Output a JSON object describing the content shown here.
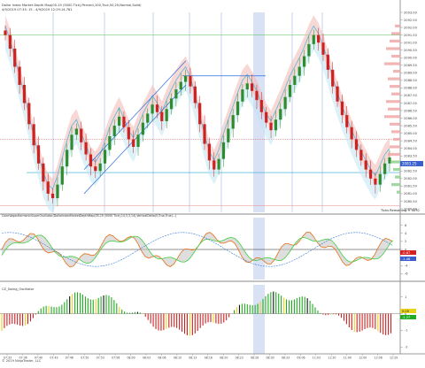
{
  "header": {
    "line1": "Dollar Index Market Depth Map(05-19 (5000 Tick),Percent,100,True,50,20,Normal,Solid)",
    "line2": "4/9/2019 07:33: 15 - 4/9/2019 12:29:14.761"
  },
  "price_panel": {
    "y_ticks": [
      "2093.00",
      "2092.50",
      "2092.00",
      "2091.50",
      "2091.00",
      "2090.50",
      "2090.00",
      "2089.50",
      "2089.00",
      "2088.50",
      "2088.00",
      "2087.50",
      "2087.00",
      "2086.50",
      "2086.00",
      "2085.50",
      "2085.00",
      "2084.50",
      "2084.00",
      "2083.50",
      "2083.00",
      "2082.50",
      "2082.00",
      "2081.50",
      "2081.00",
      "2080.50",
      "2080.00"
    ],
    "last_price": "2083.25",
    "ticks_remaining": "Ticks Remaining = 3070"
  },
  "momentum_panel": {
    "label": "ColorVagosHarmonicSuperOscillator(DollarIndexMarketDepthMap(05-19 (5000 Tick),14,3,3,14),VerticalDelta(5,True,True)...)",
    "y_ticks": [
      "6",
      "4",
      "2",
      "0",
      "-2",
      "-4",
      "-6"
    ],
    "value_labels": [
      "-0.87",
      "-1.46"
    ]
  },
  "oscillator_panel": {
    "label": "CZ_Swing_Oscillator",
    "y_ticks": [
      "1",
      "0",
      "-1",
      "-2"
    ],
    "value_labels": [
      "0.00",
      "-1.27"
    ]
  },
  "time_axis": {
    "ticks": [
      "07:33",
      "07:36",
      "07:40",
      "07:43",
      "07:46",
      "07:50",
      "07:53",
      "07:56",
      "08:00",
      "08:03",
      "08:06",
      "08:10",
      "08:13",
      "08:16",
      "08:20",
      "08:23",
      "08:26",
      "08:30",
      "08:33",
      "09:06",
      "11:03",
      "11:20",
      "11:40",
      "12:00",
      "12:06",
      "12:29"
    ]
  },
  "footer": {
    "copyright": "© 2019 NinjaTrader, LLC"
  },
  "colors": {
    "up_candle": "#2e8b2e",
    "down_candle": "#cc2222",
    "envelope_upper": "#f2b8b0",
    "envelope_lower": "#bfe6f2",
    "trend_band": "#9ad0ee",
    "hist_pos": "#22aa22",
    "hist_neg": "#cc2222",
    "hist_yellow": "#e8d21e"
  },
  "chart_data": {
    "type": "candlestick",
    "ylim": [
      2080,
      2093
    ],
    "closes": [
      2091.5,
      2090.6,
      2089.4,
      2088.2,
      2087.0,
      2085.6,
      2084.2,
      2083.0,
      2081.8,
      2081.0,
      2080.7,
      2081.6,
      2082.8,
      2083.9,
      2084.9,
      2085.3,
      2084.4,
      2083.6,
      2082.8,
      2082.5,
      2083.0,
      2083.9,
      2084.8,
      2085.5,
      2086.1,
      2085.4,
      2084.6,
      2084.1,
      2084.9,
      2085.7,
      2086.3,
      2086.9,
      2086.4,
      2085.8,
      2086.6,
      2087.3,
      2087.9,
      2088.4,
      2088.8,
      2088.1,
      2087.0,
      2085.6,
      2084.3,
      2083.2,
      2082.6,
      2083.3,
      2084.4,
      2085.3,
      2086.2,
      2087.1,
      2087.9,
      2088.3,
      2087.8,
      2087.2,
      2086.4,
      2085.7,
      2085.2,
      2085.9,
      2086.6,
      2087.4,
      2088.2,
      2088.8,
      2089.4,
      2090.1,
      2090.9,
      2091.5,
      2091.0,
      2090.2,
      2089.2,
      2088.1,
      2087.1,
      2086.2,
      2085.4,
      2084.6,
      2083.9,
      2083.2,
      2082.6,
      2082.0,
      2081.6,
      2082.3,
      2083.0,
      2083.4
    ]
  }
}
